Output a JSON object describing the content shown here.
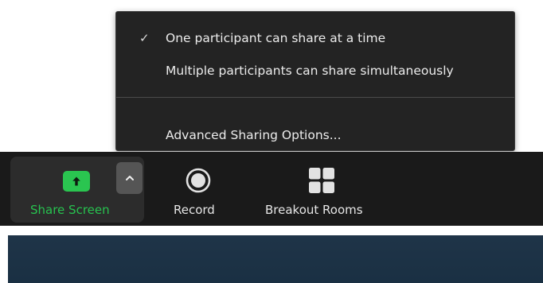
{
  "share_menu": {
    "items": [
      {
        "label": "One participant can share at a time",
        "checked": true
      },
      {
        "label": "Multiple participants can share simultaneously",
        "checked": false
      },
      {
        "label": "Advanced Sharing Options...",
        "checked": false
      }
    ],
    "check_glyph": "✓"
  },
  "toolbar": {
    "share_screen": {
      "label": "Share Screen",
      "icon": "share-screen-arrow-up-icon",
      "color": "#27c24f"
    },
    "share_options": {
      "icon": "chevron-up-icon"
    },
    "record": {
      "label": "Record",
      "icon": "record-icon"
    },
    "breakout_rooms": {
      "label": "Breakout Rooms",
      "icon": "breakout-rooms-grid-icon"
    }
  },
  "colors": {
    "menu_bg": "#232323",
    "toolbar_bg": "#1a1a1a",
    "accent_green": "#2ac550",
    "content_bg": "#1d3246"
  }
}
